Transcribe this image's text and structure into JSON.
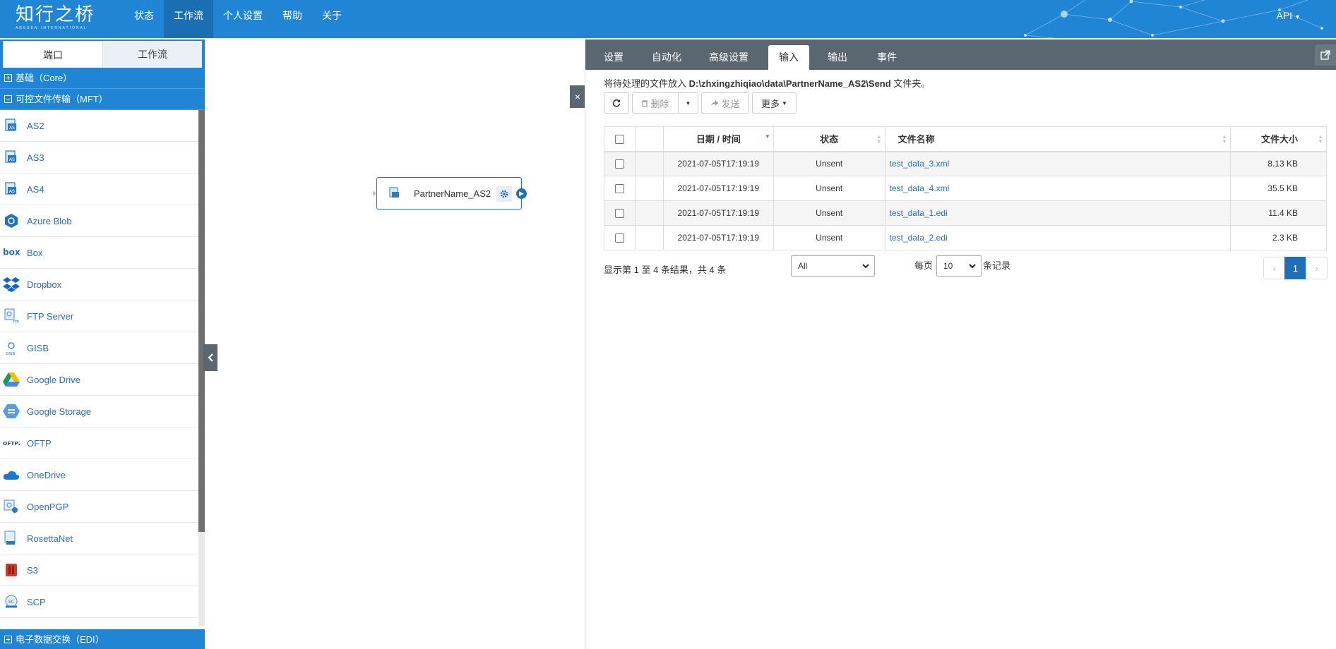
{
  "app": {
    "logo_text": "知行之桥",
    "logo_subtext": "ARESEN INTERNATIONAL"
  },
  "nav": {
    "items": [
      {
        "label": "状态"
      },
      {
        "label": "工作流",
        "active": true
      },
      {
        "label": "个人设置"
      },
      {
        "label": "帮助"
      },
      {
        "label": "关于"
      }
    ],
    "api_label": "API"
  },
  "sidebar": {
    "tabs": [
      {
        "label": "端口",
        "active": true
      },
      {
        "label": "工作流"
      }
    ],
    "categories": {
      "core": "基础（Core）",
      "mft": "可控文件传输（MFT）",
      "edi": "电子数据交换（EDI）"
    },
    "connectors": [
      {
        "label": "AS2",
        "icon": "as2-icon"
      },
      {
        "label": "AS3",
        "icon": "as3-icon"
      },
      {
        "label": "AS4",
        "icon": "as4-icon"
      },
      {
        "label": "Azure Blob",
        "icon": "azure-blob-icon"
      },
      {
        "label": "Box",
        "icon": "box-icon"
      },
      {
        "label": "Dropbox",
        "icon": "dropbox-icon"
      },
      {
        "label": "FTP Server",
        "icon": "ftp-server-icon"
      },
      {
        "label": "GISB",
        "icon": "gisb-icon"
      },
      {
        "label": "Google Drive",
        "icon": "google-drive-icon"
      },
      {
        "label": "Google Storage",
        "icon": "google-storage-icon"
      },
      {
        "label": "OFTP",
        "icon": "oftp-icon"
      },
      {
        "label": "OneDrive",
        "icon": "onedrive-icon"
      },
      {
        "label": "OpenPGP",
        "icon": "openpgp-icon"
      },
      {
        "label": "RosettaNet",
        "icon": "rosettanet-icon"
      },
      {
        "label": "S3",
        "icon": "s3-icon"
      },
      {
        "label": "SCP",
        "icon": "scp-icon"
      }
    ]
  },
  "canvas": {
    "node_label": "PartnerName_AS2",
    "close_glyph": "×"
  },
  "panel": {
    "tabs": [
      {
        "label": "设置"
      },
      {
        "label": "自动化"
      },
      {
        "label": "高级设置"
      },
      {
        "label": "输入",
        "active": true
      },
      {
        "label": "输出"
      },
      {
        "label": "事件"
      }
    ],
    "path_prefix": "将待处理的文件放入 ",
    "path": "D:\\zhxingzhiqiao\\data\\PartnerName_AS2\\Send",
    "path_suffix": " 文件夹。",
    "toolbar": {
      "delete_label": "删除",
      "send_label": "发送",
      "more_label": "更多"
    },
    "table": {
      "headers": {
        "date": "日期 / 时间",
        "status": "状态",
        "name": "文件名称",
        "size": "文件大小"
      },
      "rows": [
        {
          "date": "2021-07-05T17:19:19",
          "status": "Unsent",
          "name": "test_data_3.xml",
          "size": "8.13 KB"
        },
        {
          "date": "2021-07-05T17:19:19",
          "status": "Unsent",
          "name": "test_data_4.xml",
          "size": "35.5 KB"
        },
        {
          "date": "2021-07-05T17:19:19",
          "status": "Unsent",
          "name": "test_data_1.edi",
          "size": "11.4 KB"
        },
        {
          "date": "2021-07-05T17:19:19",
          "status": "Unsent",
          "name": "test_data_2.edi",
          "size": "2.3 KB"
        }
      ]
    },
    "footer": {
      "info": "显示第 1 至 4 条结果，共 4 条",
      "filter_value": "All",
      "per_page_prefix": "每页",
      "per_page_value": "10",
      "per_page_suffix": "条记录",
      "current_page": "1",
      "prev_glyph": "‹",
      "next_glyph": "›"
    }
  }
}
